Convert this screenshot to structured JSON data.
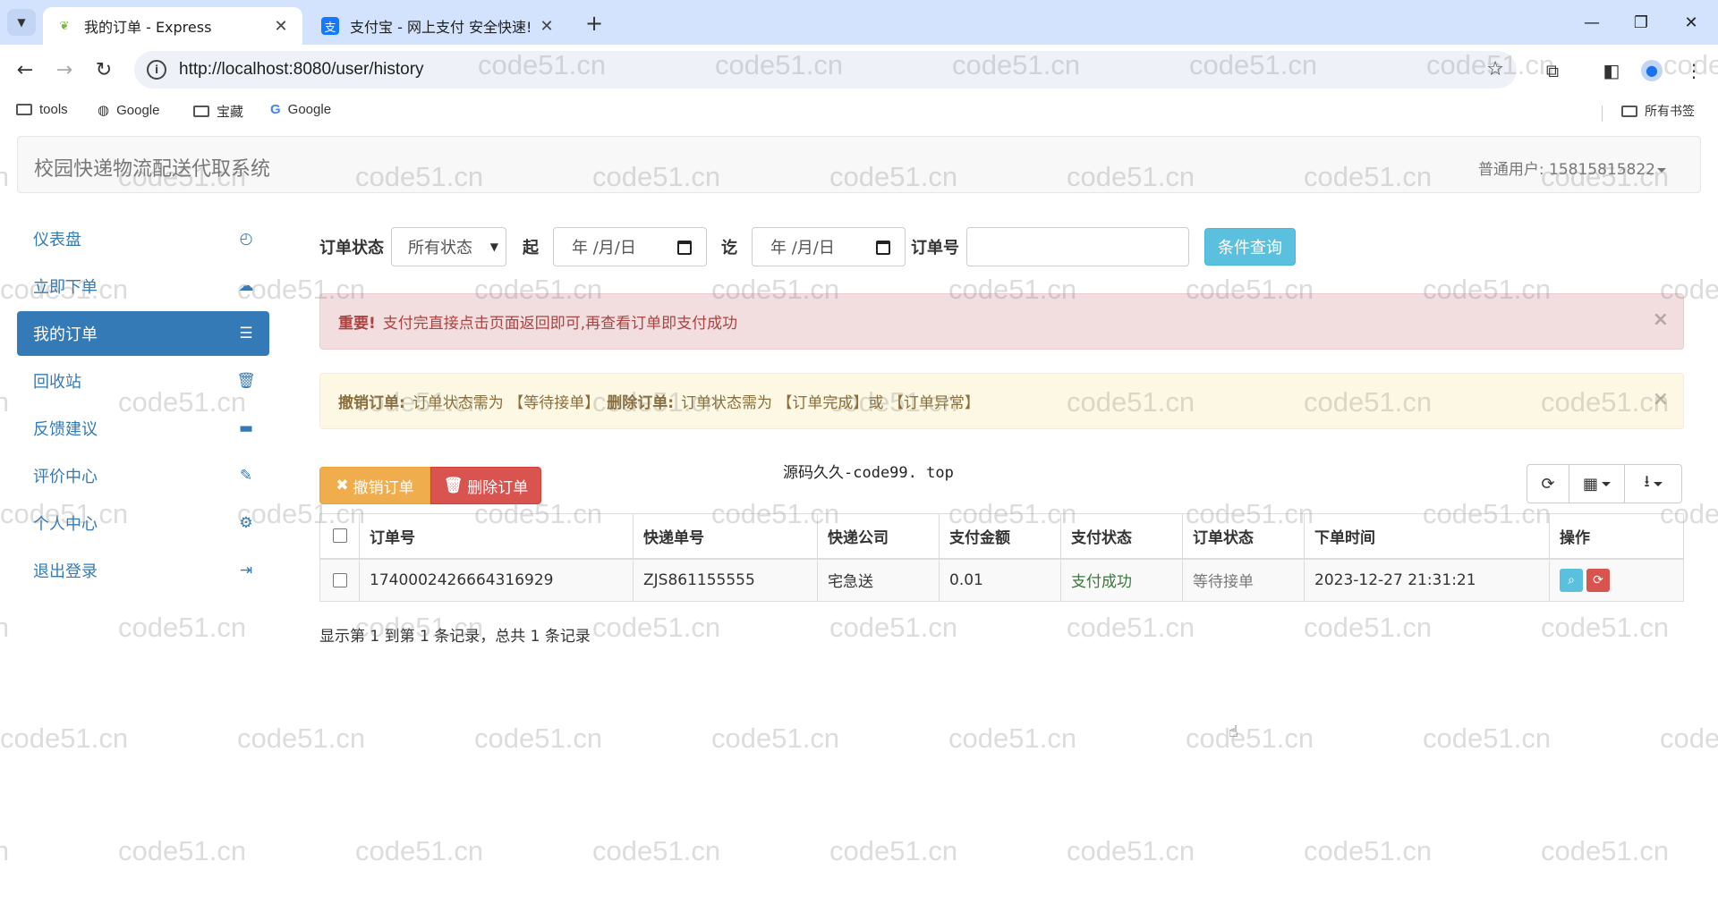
{
  "browser": {
    "tabs": [
      {
        "title": "我的订单 - Express",
        "active": true
      },
      {
        "title": "支付宝 - 网上支付 安全快速!",
        "active": false
      }
    ],
    "url": "http://localhost:8080/user/history",
    "bookmarks": [
      "tools",
      "Google",
      "宝藏",
      "Google"
    ],
    "all_bookmarks": "所有书签"
  },
  "header": {
    "brand": "校园快递物流配送代取系统",
    "user": "普通用户: 15815815822"
  },
  "sidebar": {
    "items": [
      {
        "label": "仪表盘",
        "icon": "dashboard-icon"
      },
      {
        "label": "立即下单",
        "icon": "cloud-upload-icon"
      },
      {
        "label": "我的订单",
        "icon": "list-icon",
        "active": true
      },
      {
        "label": "回收站",
        "icon": "trash-icon"
      },
      {
        "label": "反馈建议",
        "icon": "comment-icon"
      },
      {
        "label": "评价中心",
        "icon": "edit-icon"
      },
      {
        "label": "个人中心",
        "icon": "gear-icon"
      },
      {
        "label": "退出登录",
        "icon": "logout-icon"
      }
    ]
  },
  "filter": {
    "status_label": "订单状态",
    "status_value": "所有状态",
    "start_label": "起",
    "start_value": "年 /月/日",
    "end_label": "讫",
    "end_value": "年 /月/日",
    "order_no_label": "订单号",
    "order_no_value": "",
    "search_button": "条件查询"
  },
  "alerts": {
    "danger_title": "重要!",
    "danger_text": "支付完直接点击页面返回即可,再查看订单即支付成功",
    "warning_revoke_title": "撤销订单:",
    "warning_revoke_text": "订单状态需为 【等待接单】",
    "warning_delete_title": "删除订单:",
    "warning_delete_text": "订单状态需为 【订单完成】或 【订单异常】",
    "close": "×"
  },
  "table_toolbar": {
    "revoke_button": "撤销订单",
    "delete_button": "删除订单",
    "center_text": "源码久久-code99. top"
  },
  "table": {
    "columns": [
      "订单号",
      "快递单号",
      "快递公司",
      "支付金额",
      "支付状态",
      "订单状态",
      "下单时间",
      "操作"
    ],
    "rows": [
      [
        "1740002426664316929",
        "ZJS861155555",
        "宅急送",
        "0.01",
        "支付成功",
        "等待接单",
        "2023-12-27 21:31:21"
      ]
    ]
  },
  "pager_info": "显示第 1 到第 1 条记录，总共 1 条记录",
  "watermark": "code51.cn",
  "colors": {
    "primary": "#337ab7",
    "info": "#5bc0de",
    "warning": "#f0ad4e",
    "danger": "#d9534f",
    "success_text": "#3c763d"
  }
}
